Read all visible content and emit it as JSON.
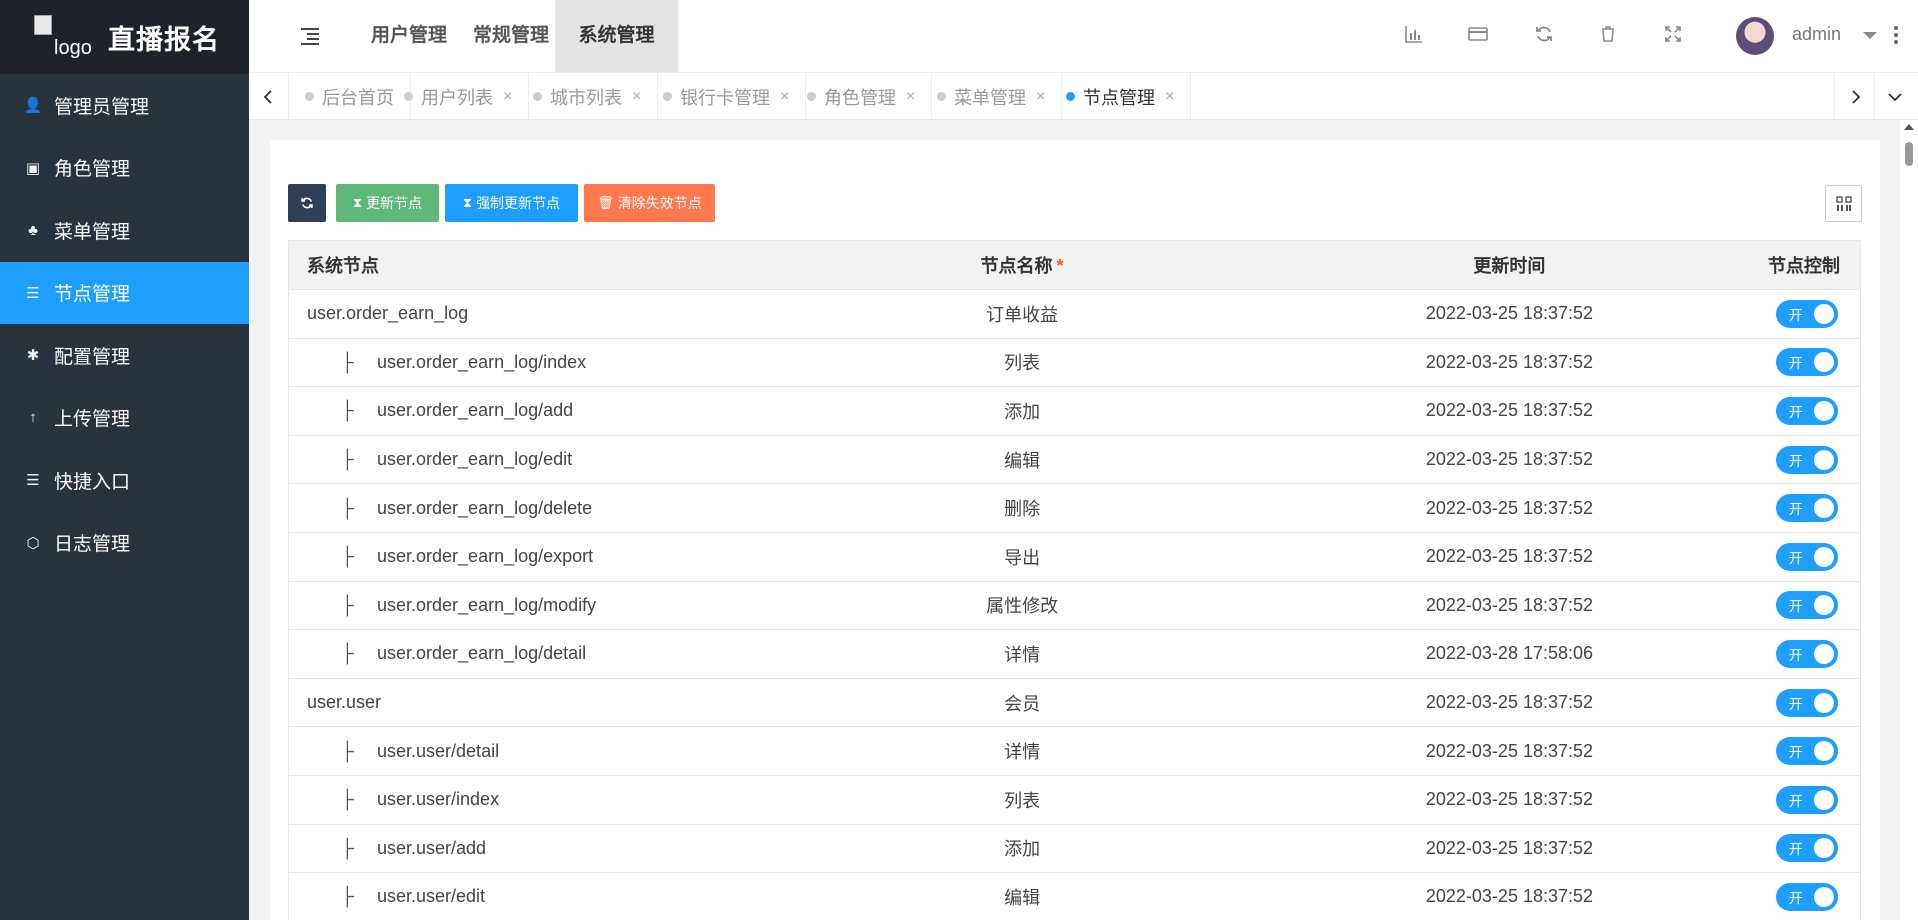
{
  "brand": {
    "logo_alt": "logo",
    "title": "直播报名"
  },
  "sidebar": {
    "items": [
      {
        "label": "管理员管理",
        "icon": "user-icon",
        "glyph": "👤"
      },
      {
        "label": "角色管理",
        "icon": "id-card-icon",
        "glyph": "▣"
      },
      {
        "label": "菜单管理",
        "icon": "tree-icon",
        "glyph": "♣"
      },
      {
        "label": "节点管理",
        "icon": "list-icon",
        "glyph": "☰",
        "active": true
      },
      {
        "label": "配置管理",
        "icon": "asterisk-icon",
        "glyph": "✱"
      },
      {
        "label": "上传管理",
        "icon": "arrow-up-icon",
        "glyph": "↑"
      },
      {
        "label": "快捷入口",
        "icon": "list-icon",
        "glyph": "☰"
      },
      {
        "label": "日志管理",
        "icon": "hexagon-icon",
        "glyph": "⬡"
      }
    ]
  },
  "header": {
    "tabs": [
      {
        "label": "用户管理"
      },
      {
        "label": "常规管理"
      },
      {
        "label": "系统管理",
        "active": true
      }
    ],
    "icons": [
      "bar-chart-icon",
      "credit-card-icon",
      "refresh-icon",
      "trash-icon",
      "fullscreen-icon"
    ],
    "user": {
      "name": "admin"
    }
  },
  "tabbar": {
    "tabs": [
      {
        "label": "后台首页",
        "closable": false
      },
      {
        "label": "用户列表",
        "closable": true
      },
      {
        "label": "城市列表",
        "closable": true
      },
      {
        "label": "银行卡管理",
        "closable": true
      },
      {
        "label": "角色管理",
        "closable": true
      },
      {
        "label": "菜单管理",
        "closable": true
      },
      {
        "label": "节点管理",
        "closable": true,
        "active": true
      }
    ],
    "close_glyph": "×"
  },
  "toolbar": {
    "update_label": "更新节点",
    "force_update_label": "强制更新节点",
    "clear_label": "清除失效节点"
  },
  "table": {
    "headers": {
      "node": "系统节点",
      "name": "节点名称",
      "required_mark": "*",
      "time": "更新时间",
      "control": "节点控制"
    },
    "tree_glyph": "├",
    "switch_on_text": "开",
    "rows": [
      {
        "node": "user.order_earn_log",
        "name": "订单收益",
        "time": "2022-03-25 18:37:52",
        "child": false
      },
      {
        "node": "user.order_earn_log/index",
        "name": "列表",
        "time": "2022-03-25 18:37:52",
        "child": true
      },
      {
        "node": "user.order_earn_log/add",
        "name": "添加",
        "time": "2022-03-25 18:37:52",
        "child": true
      },
      {
        "node": "user.order_earn_log/edit",
        "name": "编辑",
        "time": "2022-03-25 18:37:52",
        "child": true
      },
      {
        "node": "user.order_earn_log/delete",
        "name": "删除",
        "time": "2022-03-25 18:37:52",
        "child": true
      },
      {
        "node": "user.order_earn_log/export",
        "name": "导出",
        "time": "2022-03-25 18:37:52",
        "child": true
      },
      {
        "node": "user.order_earn_log/modify",
        "name": "属性修改",
        "time": "2022-03-25 18:37:52",
        "child": true
      },
      {
        "node": "user.order_earn_log/detail",
        "name": "详情",
        "time": "2022-03-28 17:58:06",
        "child": true
      },
      {
        "node": "user.user",
        "name": "会员",
        "time": "2022-03-25 18:37:52",
        "child": false
      },
      {
        "node": "user.user/detail",
        "name": "详情",
        "time": "2022-03-25 18:37:52",
        "child": true
      },
      {
        "node": "user.user/index",
        "name": "列表",
        "time": "2022-03-25 18:37:52",
        "child": true
      },
      {
        "node": "user.user/add",
        "name": "添加",
        "time": "2022-03-25 18:37:52",
        "child": true
      },
      {
        "node": "user.user/edit",
        "name": "编辑",
        "time": "2022-03-25 18:37:52",
        "child": true
      }
    ]
  },
  "colors": {
    "primary": "#1e9fff",
    "sidebar": "#28333e",
    "green": "#5fb878",
    "danger": "#ff5722",
    "dark": "#2f4056"
  }
}
